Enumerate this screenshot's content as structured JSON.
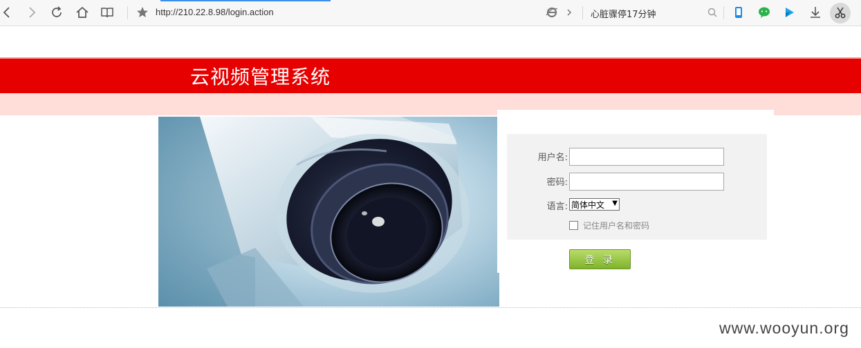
{
  "browser": {
    "url": "http://210.22.8.98/login.action",
    "news_text": "心脏骤停17分钟"
  },
  "page": {
    "system_title": "云视频管理系统",
    "username_label": "用户名:",
    "password_label": "密码:",
    "language_label": "语言:",
    "language_selected": "简体中文",
    "remember_label": "记住用户名和密码",
    "login_button": "登 录",
    "username_value": "",
    "password_value": ""
  },
  "watermark": "www.wooyun.org",
  "colors": {
    "header_red": "#e60000",
    "header_pink": "#ffddd8",
    "button_green": "#8fc33a"
  }
}
